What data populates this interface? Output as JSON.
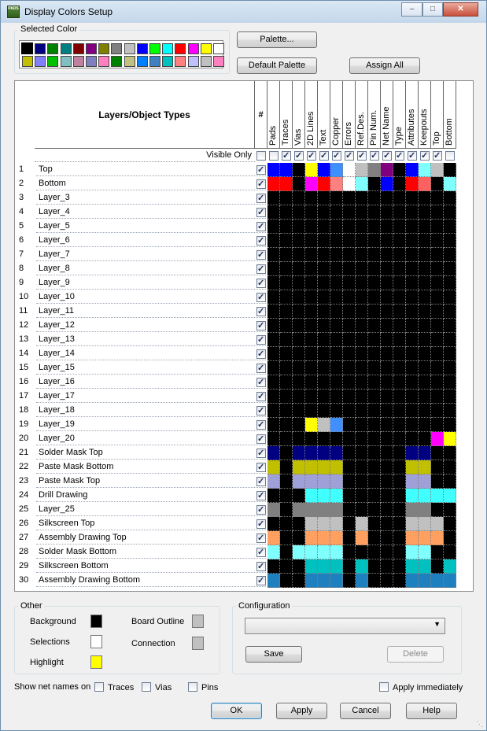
{
  "window": {
    "title": "Display Colors Setup",
    "icon_text": "PADS",
    "minimize": "‒",
    "maximize": "□",
    "close": "✕"
  },
  "selected_color": {
    "legend": "Selected Color",
    "current": "#000000",
    "row1": [
      "#000000",
      "#000080",
      "#008000",
      "#008080",
      "#800000",
      "#800080",
      "#808000",
      "#808080",
      "#c0c0c0",
      "#0000ff",
      "#00ff00",
      "#00ffff",
      "#ff0000",
      "#ff00ff",
      "#ffff00",
      "#ffffff"
    ],
    "row2": [
      "#c0c000",
      "#8080ff",
      "#00c000",
      "#80c0c0",
      "#c080a0",
      "#8080c0",
      "#ff80c0",
      "#008000",
      "#c0c080",
      "#0080ff",
      "#4080c0",
      "#00c0c0",
      "#ff8080",
      "#c0c0ff",
      "#c0c0c0",
      "#ff80c0"
    ]
  },
  "buttons": {
    "palette": "Palette...",
    "default_palette": "Default Palette",
    "assign_all": "Assign All",
    "ok": "OK",
    "apply": "Apply",
    "cancel": "Cancel",
    "help": "Help",
    "save": "Save",
    "delete": "Delete"
  },
  "grid": {
    "header_title": "Layers/Object Types",
    "hash_header": "#",
    "visible_only": "Visible Only",
    "columns": [
      "Pads",
      "Traces",
      "Vias",
      "2D Lines",
      "Text",
      "Copper",
      "Errors",
      "Ref.Des.",
      "Pin Num.",
      "Net Name",
      "Type",
      "Attributes",
      "Keepouts",
      "Top",
      "Bottom"
    ],
    "column_checked": [
      false,
      true,
      true,
      true,
      true,
      true,
      true,
      true,
      true,
      true,
      true,
      true,
      true,
      true,
      false
    ],
    "rows": [
      {
        "num": "1",
        "name": "Top",
        "colors": [
          "#0000ff",
          "#0000ff",
          "#000000",
          "#ffff00",
          "#0000ff",
          "#3f8fff",
          "#ffffff",
          "#c0c0c0",
          "#808080",
          "#800080",
          "#000000",
          "#0000ff",
          "#80ffff",
          "#c0c0c0",
          "#000000"
        ]
      },
      {
        "num": "2",
        "name": "Bottom",
        "colors": [
          "#ff0000",
          "#ff0000",
          "#000000",
          "#ff00ff",
          "#ff0000",
          "#ff8080",
          "#ffffff",
          "#80ffff",
          "#000000",
          "#0000ff",
          "#000000",
          "#ff0000",
          "#ff6060",
          "#000000",
          "#80ffff"
        ]
      },
      {
        "num": "3",
        "name": "Layer_3",
        "colors": []
      },
      {
        "num": "4",
        "name": "Layer_4",
        "colors": []
      },
      {
        "num": "5",
        "name": "Layer_5",
        "colors": []
      },
      {
        "num": "6",
        "name": "Layer_6",
        "colors": []
      },
      {
        "num": "7",
        "name": "Layer_7",
        "colors": []
      },
      {
        "num": "8",
        "name": "Layer_8",
        "colors": []
      },
      {
        "num": "9",
        "name": "Layer_9",
        "colors": []
      },
      {
        "num": "10",
        "name": "Layer_10",
        "colors": []
      },
      {
        "num": "11",
        "name": "Layer_11",
        "colors": []
      },
      {
        "num": "12",
        "name": "Layer_12",
        "colors": []
      },
      {
        "num": "13",
        "name": "Layer_13",
        "colors": []
      },
      {
        "num": "14",
        "name": "Layer_14",
        "colors": []
      },
      {
        "num": "15",
        "name": "Layer_15",
        "colors": []
      },
      {
        "num": "16",
        "name": "Layer_16",
        "colors": []
      },
      {
        "num": "17",
        "name": "Layer_17",
        "colors": []
      },
      {
        "num": "18",
        "name": "Layer_18",
        "colors": []
      },
      {
        "num": "19",
        "name": "Layer_19",
        "colors": [
          "#000000",
          "#000000",
          "#000000",
          "#ffff00",
          "#c0c0c0",
          "#3f8fff",
          "#000000",
          "#000000",
          "#000000",
          "#000000",
          "#000000",
          "#000000",
          "#000000",
          "#000000",
          "#000000"
        ]
      },
      {
        "num": "20",
        "name": "Layer_20",
        "colors": [
          "#000000",
          "#000000",
          "#000000",
          "#000000",
          "#000000",
          "#000000",
          "#000000",
          "#000000",
          "#000000",
          "#000000",
          "#000000",
          "#000000",
          "#000000",
          "#ff00ff",
          "#ffff00"
        ]
      },
      {
        "num": "21",
        "name": "Solder Mask Top",
        "colors": [
          "#000080",
          "#000000",
          "#000080",
          "#000080",
          "#000080",
          "#000080",
          "#000000",
          "#000000",
          "#000000",
          "#000000",
          "#000000",
          "#000080",
          "#000080",
          "#000000",
          "#000000"
        ]
      },
      {
        "num": "22",
        "name": "Paste Mask Bottom",
        "colors": [
          "#c0c000",
          "#000000",
          "#c0c000",
          "#c0c000",
          "#c0c000",
          "#c0c000",
          "#000000",
          "#000000",
          "#000000",
          "#000000",
          "#000000",
          "#c0c000",
          "#c0c000",
          "#000000",
          "#000000"
        ]
      },
      {
        "num": "23",
        "name": "Paste Mask Top",
        "colors": [
          "#a0a0d8",
          "#000000",
          "#a0a0d8",
          "#a0a0d8",
          "#a0a0d8",
          "#a0a0d8",
          "#000000",
          "#000000",
          "#000000",
          "#000000",
          "#000000",
          "#a0a0d8",
          "#a0a0d8",
          "#000000",
          "#000000"
        ]
      },
      {
        "num": "24",
        "name": "Drill Drawing",
        "colors": [
          "#000000",
          "#000000",
          "#000000",
          "#40ffff",
          "#40ffff",
          "#40ffff",
          "#000000",
          "#000000",
          "#000000",
          "#000000",
          "#000000",
          "#40ffff",
          "#40ffff",
          "#40ffff",
          "#40ffff"
        ]
      },
      {
        "num": "25",
        "name": "Layer_25",
        "colors": [
          "#808080",
          "#000000",
          "#808080",
          "#808080",
          "#808080",
          "#808080",
          "#000000",
          "#000000",
          "#000000",
          "#000000",
          "#000000",
          "#808080",
          "#808080",
          "#000000",
          "#000000"
        ]
      },
      {
        "num": "26",
        "name": "Silkscreen Top",
        "colors": [
          "#000000",
          "#000000",
          "#000000",
          "#c0c0c0",
          "#c0c0c0",
          "#c0c0c0",
          "#000000",
          "#c0c0c0",
          "#000000",
          "#000000",
          "#000000",
          "#c0c0c0",
          "#c0c0c0",
          "#c0c0c0",
          "#000000"
        ]
      },
      {
        "num": "27",
        "name": "Assembly Drawing Top",
        "colors": [
          "#ffa060",
          "#000000",
          "#000000",
          "#ffa060",
          "#ffa060",
          "#ffa060",
          "#000000",
          "#ffa060",
          "#000000",
          "#000000",
          "#000000",
          "#ffa060",
          "#ffa060",
          "#ffa060",
          "#000000"
        ]
      },
      {
        "num": "28",
        "name": "Solder Mask Bottom",
        "colors": [
          "#80ffff",
          "#000000",
          "#80ffff",
          "#80ffff",
          "#80ffff",
          "#80ffff",
          "#000000",
          "#000000",
          "#000000",
          "#000000",
          "#000000",
          "#80ffff",
          "#80ffff",
          "#000000",
          "#000000"
        ]
      },
      {
        "num": "29",
        "name": "Silkscreen Bottom",
        "colors": [
          "#000000",
          "#000000",
          "#000000",
          "#00c0c0",
          "#00c0c0",
          "#00c0c0",
          "#000000",
          "#00c0c0",
          "#000000",
          "#000000",
          "#000000",
          "#00c0c0",
          "#00c0c0",
          "#000000",
          "#00c0c0"
        ]
      },
      {
        "num": "30",
        "name": "Assembly Drawing Bottom",
        "colors": [
          "#1f80c0",
          "#000000",
          "#000000",
          "#1f80c0",
          "#1f80c0",
          "#1f80c0",
          "#000000",
          "#1f80c0",
          "#000000",
          "#000000",
          "#000000",
          "#1f80c0",
          "#1f80c0",
          "#1f80c0",
          "#1f80c0"
        ]
      }
    ]
  },
  "other": {
    "legend": "Other",
    "background": {
      "label": "Background",
      "color": "#000000"
    },
    "selections": {
      "label": "Selections",
      "color": "#ffffff"
    },
    "highlight": {
      "label": "Highlight",
      "color": "#ffff00"
    },
    "board_outline": {
      "label": "Board Outline",
      "color": "#c0c0c0"
    },
    "connection": {
      "label": "Connection",
      "color": "#c0c0c0"
    }
  },
  "configuration": {
    "legend": "Configuration",
    "value": ""
  },
  "netnames": {
    "label": "Show net names on",
    "traces": "Traces",
    "vias": "Vias",
    "pins": "Pins",
    "apply_immediately": "Apply immediately"
  }
}
